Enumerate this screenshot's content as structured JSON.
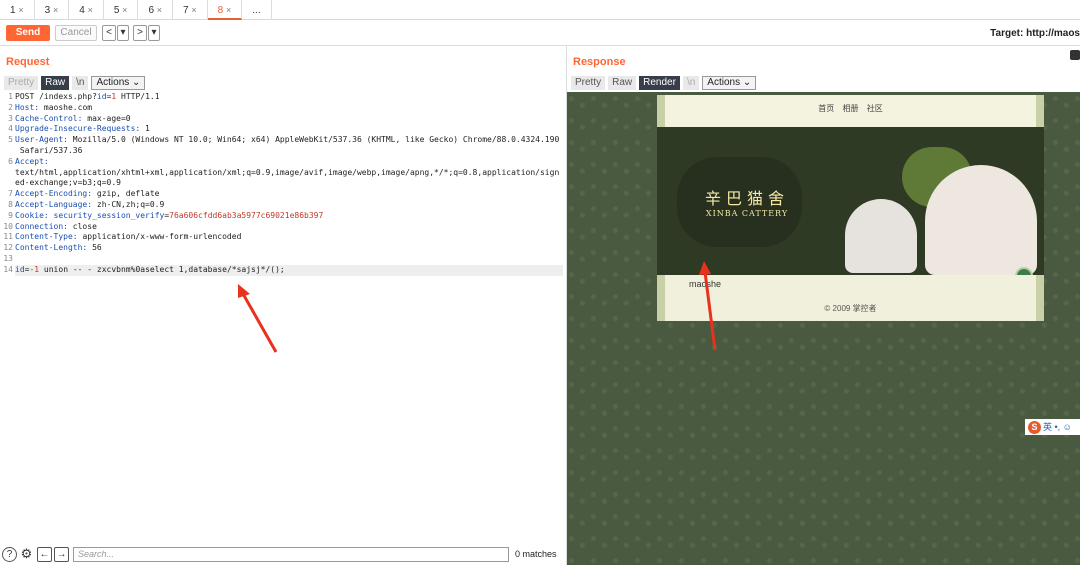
{
  "tabs": [
    {
      "label": "1",
      "close": "×"
    },
    {
      "label": "3",
      "close": "×"
    },
    {
      "label": "4",
      "close": "×"
    },
    {
      "label": "5",
      "close": "×"
    },
    {
      "label": "6",
      "close": "×"
    },
    {
      "label": "7",
      "close": "×"
    },
    {
      "label": "8",
      "close": "×",
      "active": true
    },
    {
      "label": "...",
      "close": ""
    }
  ],
  "toolbar": {
    "send": "Send",
    "cancel": "Cancel",
    "back": "<",
    "back_dd": "▾",
    "fwd": ">",
    "fwd_dd": "▾",
    "target": "Target: http://maos"
  },
  "request": {
    "title": "Request",
    "tabs": [
      "Pretty",
      "Raw",
      "\\n",
      "Actions ⌄"
    ],
    "line_numbers": [
      "1",
      "2",
      "3",
      "4",
      "5",
      "",
      "6",
      "",
      "",
      "7",
      "8",
      "9",
      "10",
      "11",
      "12",
      "13",
      "14"
    ]
  },
  "response": {
    "title": "Response",
    "tabs": [
      "Pretty",
      "Raw",
      "Render",
      "\\n",
      "Actions ⌄"
    ]
  },
  "rendered_site": {
    "nav": "首页 相册 社区",
    "title_cn": "辛巴猫舍",
    "title_en": "XINBA CATTERY",
    "body_text": "maoshe",
    "copyright": "© 2009 掌控者"
  },
  "bottom": {
    "help": "?",
    "settings": "⚙",
    "prev": "←",
    "next": "→",
    "search_placeholder": "Search...",
    "matches": "0 matches"
  },
  "ime": {
    "logo": "S",
    "text": "英 •, ☺"
  }
}
